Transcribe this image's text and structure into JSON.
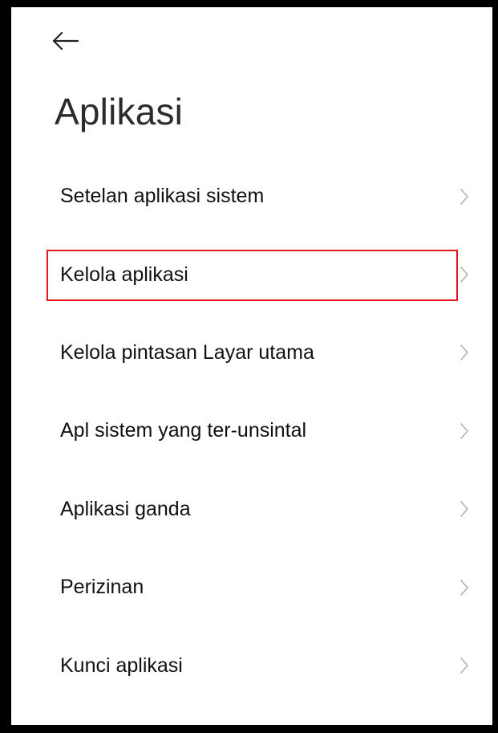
{
  "header": {
    "back_icon": "back-arrow-icon",
    "title": "Aplikasi"
  },
  "menu": {
    "items": [
      {
        "label": "Setelan aplikasi sistem",
        "icon": "chevron-right-icon"
      },
      {
        "label": "Kelola aplikasi",
        "icon": "chevron-right-icon",
        "highlighted": true
      },
      {
        "label": "Kelola pintasan Layar utama",
        "icon": "chevron-right-icon"
      },
      {
        "label": "Apl sistem yang ter-unsintal",
        "icon": "chevron-right-icon"
      },
      {
        "label": "Aplikasi ganda",
        "icon": "chevron-right-icon"
      },
      {
        "label": "Perizinan",
        "icon": "chevron-right-icon"
      },
      {
        "label": "Kunci aplikasi",
        "icon": "chevron-right-icon"
      }
    ]
  },
  "colors": {
    "background": "#ffffff",
    "text": "#111111",
    "title": "#2b2b2b",
    "chevron": "#b0b0b0",
    "highlight": "#e8141c",
    "frame": "#000000"
  }
}
